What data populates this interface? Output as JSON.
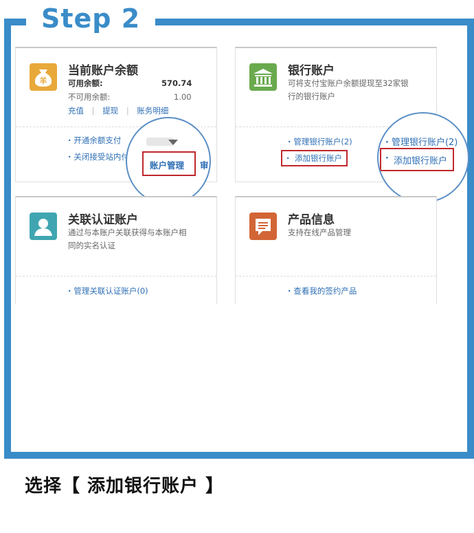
{
  "step": {
    "title": "Step 2"
  },
  "balance_card": {
    "icon": "money-bag-icon",
    "icon_glyph": "羊",
    "title": "当前账户余额",
    "available_label": "可用余额:",
    "available_value": "570.74",
    "unavailable_label": "不可用余额:",
    "unavailable_value": "1.00",
    "actions": [
      "充值",
      "提现",
      "账务明细"
    ],
    "separator": "|",
    "links": [
      "开通余额支付",
      "关闭接受站内付"
    ],
    "zoom_button": "账户管理",
    "zoom_partial": "审"
  },
  "bank_card": {
    "icon": "bank-icon",
    "title": "银行账户",
    "desc_line1": "可将支付宝账户余额提现至32家银",
    "desc_line2": "行的银行账户",
    "links": [
      "管理银行账户(2)",
      "添加银行账户"
    ],
    "zoom_link1": "管理银行账户(2)",
    "zoom_link2": "添加银行账户"
  },
  "identity_card": {
    "icon": "user-icon",
    "title": "关联认证账户",
    "desc_line1": "通过与本账户关联获得与本账户相",
    "desc_line2": "同的实名认证",
    "link": "管理关联认证账户(0)"
  },
  "product_card": {
    "icon": "document-icon",
    "title": "产品信息",
    "desc": "支持在线产品管理",
    "link": "查看我的签约产品"
  },
  "caption": "选择【 添加银行账户 】",
  "colors": {
    "frame": "#3a8cc8",
    "link": "#2f6fb5",
    "highlight": "#c0272d"
  }
}
